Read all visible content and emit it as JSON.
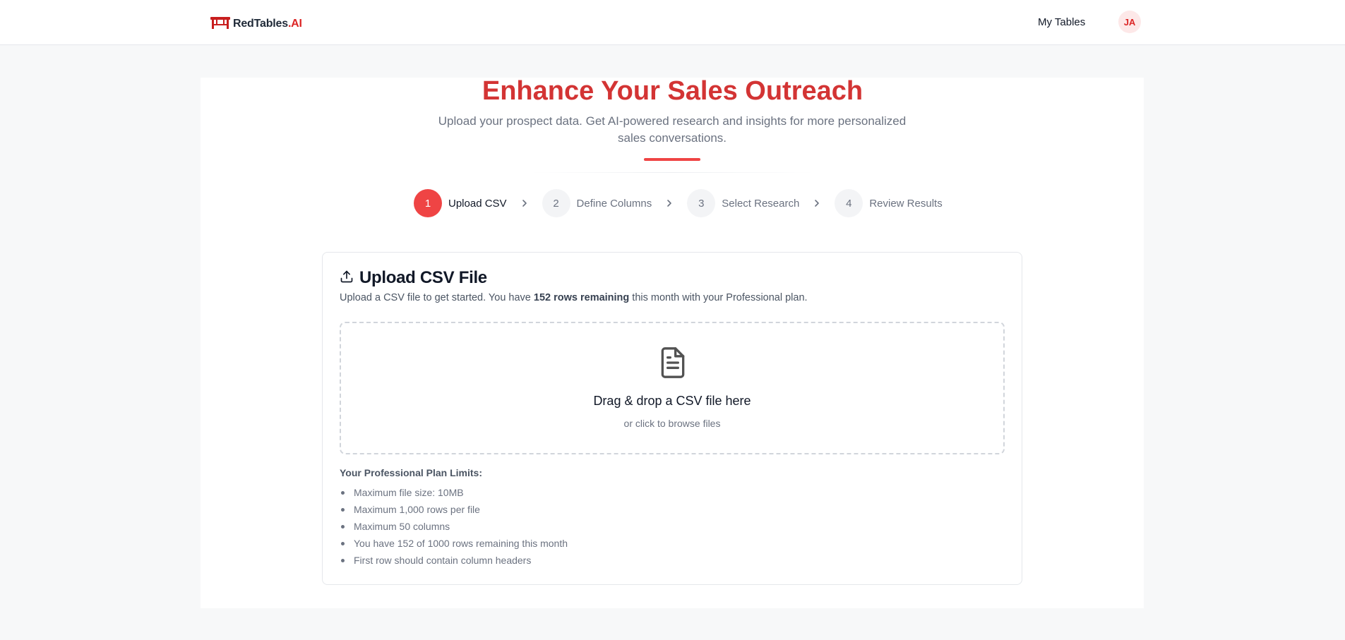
{
  "header": {
    "logo_text": "RedTables",
    "logo_suffix": ".AI",
    "nav_my_tables": "My Tables",
    "avatar_initials": "JA"
  },
  "hero": {
    "title": "Enhance Your Sales Outreach",
    "subtitle": "Upload your prospect data. Get AI-powered research and insights for more personalized sales conversations."
  },
  "steps": [
    {
      "number": "1",
      "label": "Upload CSV",
      "active": true
    },
    {
      "number": "2",
      "label": "Define Columns",
      "active": false
    },
    {
      "number": "3",
      "label": "Select Research",
      "active": false
    },
    {
      "number": "4",
      "label": "Review Results",
      "active": false
    }
  ],
  "upload_card": {
    "title": "Upload CSV File",
    "desc_before": "Upload a CSV file to get started. You have ",
    "desc_bold": "152 rows remaining",
    "desc_after": " this month with your Professional plan.",
    "dropzone_title": "Drag & drop a CSV file here",
    "dropzone_sub": "or click to browse files",
    "limits_title": "Your Professional Plan Limits:",
    "limits": [
      "Maximum file size: 10MB",
      "Maximum 1,000 rows per file",
      "Maximum 50 columns",
      "You have 152 of 1000 rows remaining this month",
      "First row should contain column headers"
    ]
  },
  "colors": {
    "brand_red": "#d33434",
    "accent_red": "#ef4444",
    "avatar_bg": "#fde8e8"
  },
  "icons": {
    "logo": "table-icon",
    "card_title": "upload-icon",
    "dropzone": "file-text-icon",
    "step_separator": "chevron-right-icon"
  }
}
